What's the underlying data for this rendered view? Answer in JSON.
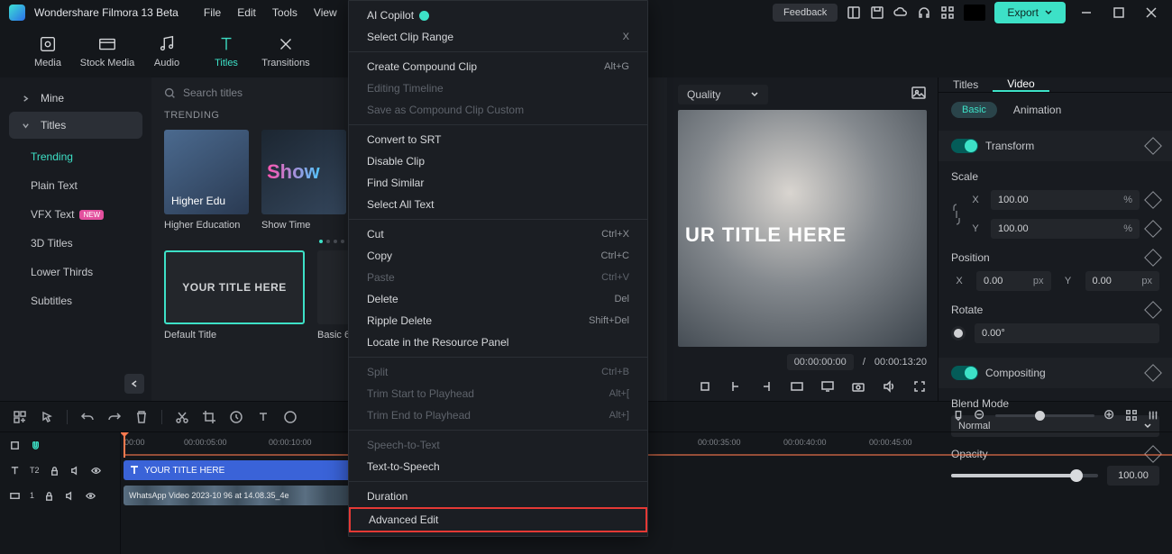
{
  "app": {
    "name": "Wondershare Filmora 13 Beta"
  },
  "menu": [
    "File",
    "Edit",
    "Tools",
    "View"
  ],
  "titlebar": {
    "feedback": "Feedback",
    "export": "Export"
  },
  "modes": [
    {
      "id": "media",
      "label": "Media"
    },
    {
      "id": "stock",
      "label": "Stock Media"
    },
    {
      "id": "audio",
      "label": "Audio"
    },
    {
      "id": "titles",
      "label": "Titles"
    },
    {
      "id": "transitions",
      "label": "Transitions"
    }
  ],
  "sidebar": {
    "mine": "Mine",
    "titles": "Titles",
    "sub": [
      "Trending",
      "Plain Text",
      "VFX Text",
      "3D Titles",
      "Lower Thirds",
      "Subtitles"
    ]
  },
  "browser": {
    "search_ph": "Search titles",
    "section": "TRENDING",
    "thumbs": [
      {
        "title": "Higher Edu",
        "caption": "Higher Education"
      },
      {
        "title": "Show",
        "caption": "Show Time"
      }
    ],
    "defaults": [
      {
        "title": "YOUR TITLE HERE",
        "caption": "Default Title"
      },
      {
        "title": "",
        "caption": "Basic 6"
      }
    ]
  },
  "preview": {
    "quality": "Quality",
    "overlay": "UR TITLE HERE",
    "cur": "00:00:00:00",
    "dur": "00:00:13:20"
  },
  "inspector": {
    "tabs": [
      "Titles",
      "Video"
    ],
    "subtabs": [
      "Basic",
      "Animation"
    ],
    "transform": "Transform",
    "scale": "Scale",
    "axes": {
      "x": "X",
      "y": "Y"
    },
    "scale_val": "100.00",
    "pct": "%",
    "position": "Position",
    "pos_x": "0.00",
    "pos_y": "0.00",
    "px": "px",
    "rotate": "Rotate",
    "rot_val": "0.00°",
    "compositing": "Compositing",
    "blend": "Blend Mode",
    "blend_val": "Normal",
    "opacity": "Opacity",
    "op_val": "100.00"
  },
  "timeline": {
    "marks": [
      "00:00",
      "00:00:05:00",
      "00:00:10:00",
      "00:00:35:00",
      "00:00:40:00",
      "00:00:45:00"
    ],
    "track_t_label": "T2",
    "track_v_label": "1",
    "title_clip": "YOUR TITLE HERE",
    "video_clip": "WhatsApp Video 2023-10  96 at 14.08.35_4e"
  },
  "context_menu": {
    "groups": [
      [
        {
          "l": "AI Copilot",
          "ai": true
        },
        {
          "l": "Select Clip Range",
          "sc": "X"
        }
      ],
      [
        {
          "l": "Create Compound Clip",
          "sc": "Alt+G"
        },
        {
          "l": "Editing Timeline",
          "dis": true
        },
        {
          "l": "Save as Compound Clip Custom",
          "dis": true
        }
      ],
      [
        {
          "l": "Convert to SRT"
        },
        {
          "l": "Disable Clip"
        },
        {
          "l": "Find Similar"
        },
        {
          "l": "Select All Text"
        }
      ],
      [
        {
          "l": "Cut",
          "sc": "Ctrl+X"
        },
        {
          "l": "Copy",
          "sc": "Ctrl+C"
        },
        {
          "l": "Paste",
          "sc": "Ctrl+V",
          "dis": true
        },
        {
          "l": "Delete",
          "sc": "Del"
        },
        {
          "l": "Ripple Delete",
          "sc": "Shift+Del"
        },
        {
          "l": "Locate in the Resource Panel"
        }
      ],
      [
        {
          "l": "Split",
          "sc": "Ctrl+B",
          "dis": true
        },
        {
          "l": "Trim Start to Playhead",
          "sc": "Alt+[",
          "dis": true
        },
        {
          "l": "Trim End to Playhead",
          "sc": "Alt+]",
          "dis": true
        }
      ],
      [
        {
          "l": "Speech-to-Text",
          "dis": true
        },
        {
          "l": "Text-to-Speech"
        }
      ],
      [
        {
          "l": "Duration"
        },
        {
          "l": "Advanced Edit",
          "hl": true
        }
      ]
    ]
  }
}
